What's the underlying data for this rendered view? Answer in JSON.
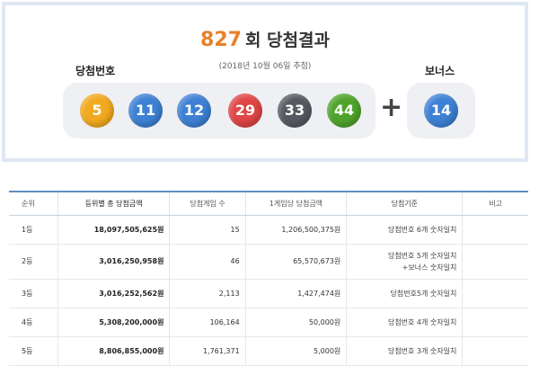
{
  "header": {
    "round": "827",
    "round_suffix": "회 당첨결과",
    "date": "(2018년 10월 06일 추첨)"
  },
  "labels": {
    "winning": "당첨번호",
    "bonus": "보너스",
    "plus": "+"
  },
  "winning_numbers": [
    {
      "value": "5",
      "color": "#f2a91f"
    },
    {
      "value": "11",
      "color": "#3d80d4"
    },
    {
      "value": "12",
      "color": "#3d80d4"
    },
    {
      "value": "29",
      "color": "#e04545"
    },
    {
      "value": "33",
      "color": "#555a60"
    },
    {
      "value": "44",
      "color": "#4fa32c"
    }
  ],
  "bonus_number": {
    "value": "14",
    "color": "#3d80d4"
  },
  "table": {
    "headers": [
      "순위",
      "등위별 총 당첨금액",
      "당첨게임 수",
      "1게임당 당첨금액",
      "당첨기준",
      "비고"
    ],
    "rows": [
      {
        "rank": "1등",
        "total": "18,097,505,625원",
        "games": "15",
        "per_game": "1,206,500,375원",
        "criteria": [
          "당첨번호 6개 숫자일치"
        ],
        "note": ""
      },
      {
        "rank": "2등",
        "total": "3,016,250,958원",
        "games": "46",
        "per_game": "65,570,673원",
        "criteria": [
          "당첨번호 5개 숫자일치",
          "+보너스 숫자일치"
        ],
        "note": ""
      },
      {
        "rank": "3등",
        "total": "3,016,252,562원",
        "games": "2,113",
        "per_game": "1,427,474원",
        "criteria": [
          "당첨번호5개 숫자일치"
        ],
        "note": ""
      },
      {
        "rank": "4등",
        "total": "5,308,200,000원",
        "games": "106,164",
        "per_game": "50,000원",
        "criteria": [
          "당첨번호 4개 숫자일치"
        ],
        "note": ""
      },
      {
        "rank": "5등",
        "total": "8,806,855,000원",
        "games": "1,761,371",
        "per_game": "5,000원",
        "criteria": [
          "당첨번호 3개 숫자일치"
        ],
        "note": ""
      }
    ]
  }
}
